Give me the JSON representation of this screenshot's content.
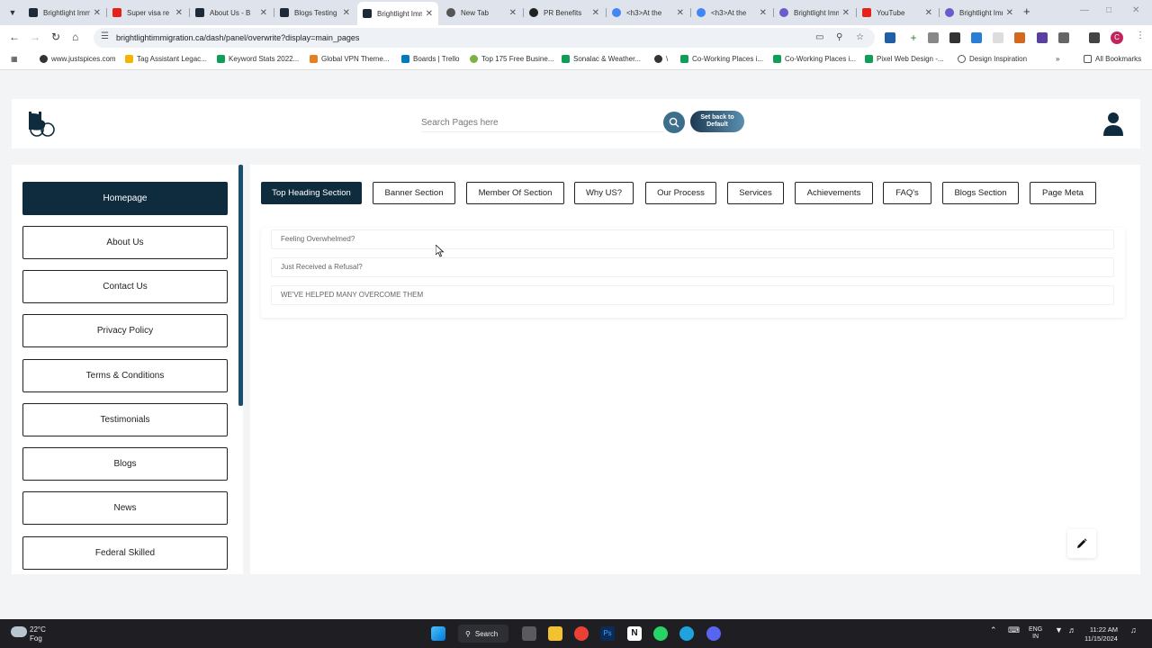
{
  "browser": {
    "tabs": [
      {
        "label": "Brightlight Imm",
        "favicon_color": "#1e2a38"
      },
      {
        "label": "Super visa re",
        "favicon_color": "#e62117"
      },
      {
        "label": "About Us - B",
        "favicon_color": "#1e2a38"
      },
      {
        "label": "Blogs Testing",
        "favicon_color": "#1e2a38"
      },
      {
        "label": "Brightlight Imm",
        "favicon_color": "#1e2a38",
        "active": true
      },
      {
        "label": "New Tab",
        "favicon_color": "#555555"
      },
      {
        "label": "PR Benefits",
        "favicon_color": "#222222"
      },
      {
        "label": "<h3>At the",
        "favicon_color": "#4285f4"
      },
      {
        "label": "<h3>At the",
        "favicon_color": "#4285f4"
      },
      {
        "label": "Brightlight Imm",
        "favicon_color": "#6a5acd"
      },
      {
        "label": "YouTube",
        "favicon_color": "#e62117"
      },
      {
        "label": "Brightlight Imm",
        "favicon_color": "#6a5acd"
      }
    ],
    "url": "brightlightimmigration.ca/dash/panel/overwrite?display=main_pages",
    "bookmarks": [
      {
        "label": "www.justspices.com",
        "color": "#333333"
      },
      {
        "label": "Tag Assistant Legac...",
        "color": "#f4b400"
      },
      {
        "label": "Keyword Stats 2022...",
        "color": "#0f9d58"
      },
      {
        "label": "Global VPN Theme...",
        "color": "#e67e22"
      },
      {
        "label": "Boards | Trello",
        "color": "#0079bf"
      },
      {
        "label": "Top 175 Free Busine...",
        "color": "#7cb342"
      },
      {
        "label": "Sonalac & Weather...",
        "color": "#0f9d58"
      },
      {
        "label": "\\",
        "color": "#333333"
      },
      {
        "label": "Co-Working Places i...",
        "color": "#0f9d58"
      },
      {
        "label": "Co-Working Places i...",
        "color": "#0f9d58"
      },
      {
        "label": "Pixel Web Design -...",
        "color": "#0f9d58"
      },
      {
        "label": "Design Inspiration",
        "color": "#555555"
      }
    ],
    "all_bookmarks": "All Bookmarks"
  },
  "header": {
    "search_placeholder": "Search Pages here",
    "reset_line1": "Set back to",
    "reset_line2": "Default"
  },
  "sidebar": {
    "items": [
      {
        "label": "Homepage",
        "active": true
      },
      {
        "label": "About Us"
      },
      {
        "label": "Contact Us"
      },
      {
        "label": "Privacy Policy"
      },
      {
        "label": "Terms & Conditions"
      },
      {
        "label": "Testimonials"
      },
      {
        "label": "Blogs"
      },
      {
        "label": "News"
      },
      {
        "label": "Federal Skilled"
      }
    ]
  },
  "sections": {
    "tabs": [
      {
        "label": "Top Heading Section",
        "active": true
      },
      {
        "label": "Banner Section"
      },
      {
        "label": "Member Of Section"
      },
      {
        "label": "Why US?"
      },
      {
        "label": "Our Process"
      },
      {
        "label": "Services"
      },
      {
        "label": "Achievements"
      },
      {
        "label": "FAQ's"
      },
      {
        "label": "Blogs Section"
      },
      {
        "label": "Page Meta"
      }
    ]
  },
  "content": {
    "fields": [
      "Feeling Overwhelmed?",
      "Just Received a Refusal?",
      "WE'VE HELPED MANY OVERCOME THEM"
    ]
  },
  "taskbar": {
    "temperature": "22°C",
    "condition": "Fog",
    "search_label": "Search",
    "lang_1": "ENG",
    "lang_2": "IN",
    "time": "11:22 AM",
    "date": "11/15/2024"
  },
  "colors": {
    "primary_dark": "#0f2b3e",
    "search_blue": "#3d6f8c"
  }
}
